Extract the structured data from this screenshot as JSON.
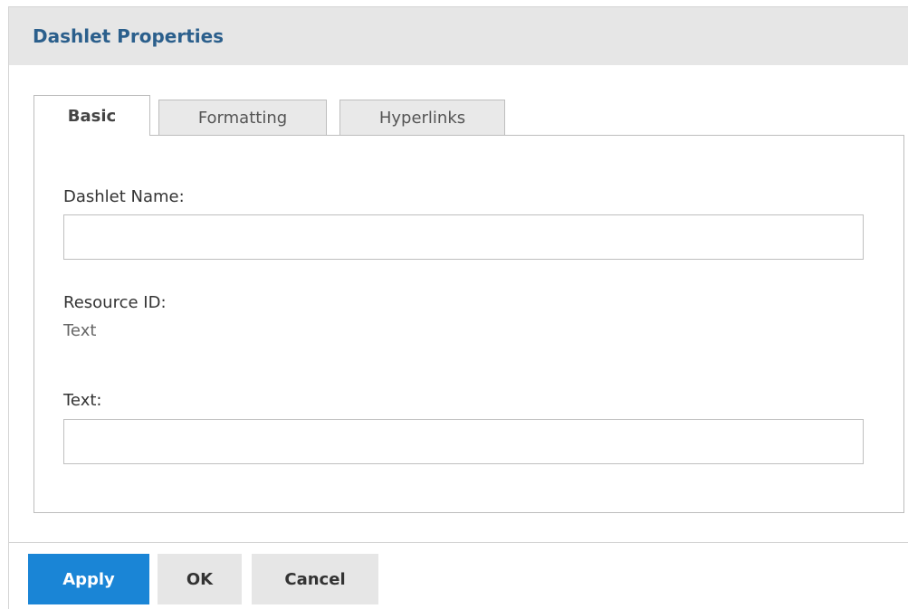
{
  "dialog": {
    "title": "Dashlet Properties"
  },
  "tabs": [
    {
      "label": "Basic",
      "active": true
    },
    {
      "label": "Formatting",
      "active": false
    },
    {
      "label": "Hyperlinks",
      "active": false
    }
  ],
  "fields": {
    "dashlet_name_label": "Dashlet Name:",
    "dashlet_name_value": "",
    "resource_id_label": "Resource ID:",
    "resource_id_value": "Text",
    "text_label": "Text:",
    "text_value": ""
  },
  "buttons": {
    "apply": "Apply",
    "ok": "OK",
    "cancel": "Cancel"
  },
  "colors": {
    "title": "#2b5f8c",
    "titlebar_bg": "#e6e6e6",
    "primary_button": "#1a85d6",
    "secondary_button": "#e6e6e6"
  }
}
